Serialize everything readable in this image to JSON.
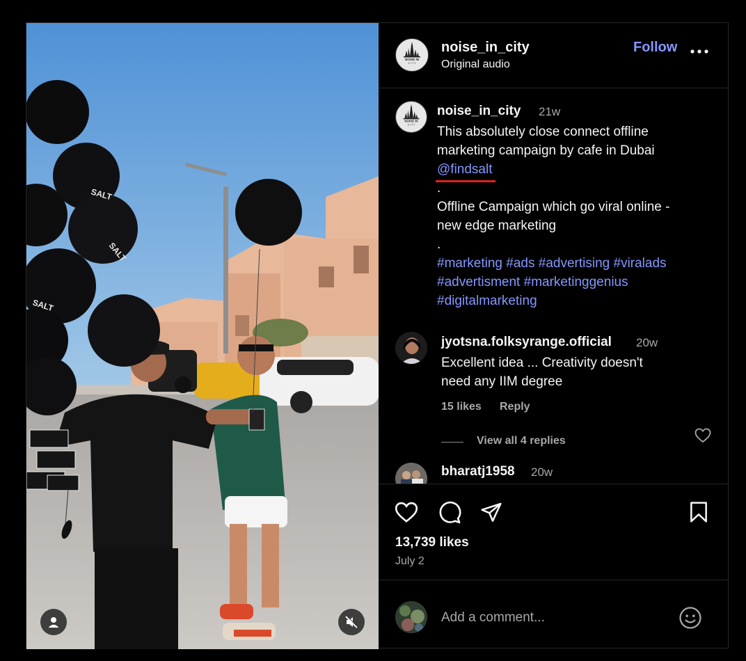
{
  "header": {
    "username": "noise_in_city",
    "audio": "Original audio",
    "follow_label": "Follow",
    "logo_text_top": "NOISE IN",
    "logo_text_bottom": "C I T Y"
  },
  "caption": {
    "username": "noise_in_city",
    "time": "21w",
    "line1": "This absolutely close connect offline",
    "line2": "marketing campaign by cafe in Dubai",
    "mention": "@findsalt",
    "dot1": ".",
    "line3": "Offline Campaign which go viral online -",
    "line4": "new edge marketing",
    "dot2": ".",
    "tags": [
      "#marketing",
      "#ads",
      "#advertising",
      "#viralads",
      "#advertisment",
      "#marketinggenius",
      "#digitalmarketing"
    ]
  },
  "comments": [
    {
      "username": "jyotsna.folksyrange.official",
      "time": "20w",
      "text_line1": "Excellent idea ... Creativity doesn't",
      "text_line2": "need any IIM degree",
      "likes": "15 likes",
      "reply_label": "Reply",
      "view_replies": "View all 4 replies"
    },
    {
      "username": "bharatj1958",
      "time": "20w"
    }
  ],
  "actions": {
    "likes": "13,739 likes",
    "date": "July 2"
  },
  "add_comment": {
    "placeholder": "Add a comment..."
  },
  "media": {
    "balloon_text": "SALT"
  },
  "colors": {
    "accent": "#8497ff",
    "muted": "#a8a8a8",
    "underline": "#e02020",
    "background": "#000000"
  }
}
